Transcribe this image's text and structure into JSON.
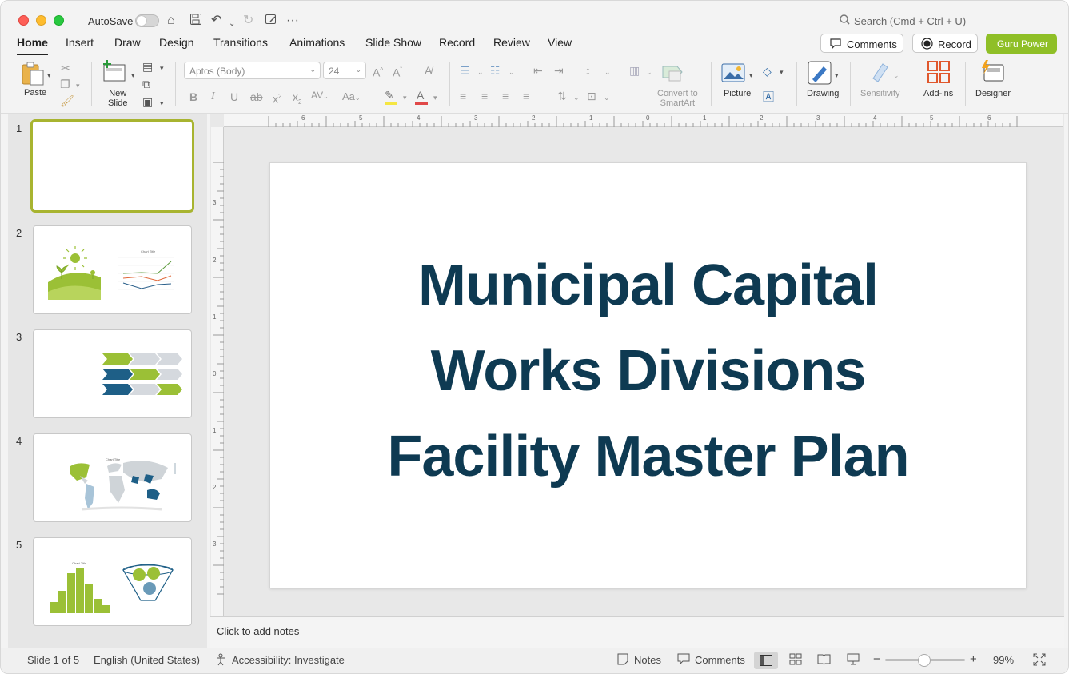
{
  "titlebar": {
    "autosave_label": "AutoSave",
    "search_placeholder": "Search (Cmd + Ctrl + U)"
  },
  "tabs": [
    "Home",
    "Insert",
    "Draw",
    "Design",
    "Transitions",
    "Animations",
    "Slide Show",
    "Record",
    "Review",
    "View"
  ],
  "header_buttons": {
    "comments": "Comments",
    "record": "Record",
    "guru": "Guru Power"
  },
  "ribbon": {
    "paste": "Paste",
    "new_slide_line1": "New",
    "new_slide_line2": "Slide",
    "font_name": "Aptos (Body)",
    "font_size": "24",
    "convert_line1": "Convert to",
    "convert_line2": "SmartArt",
    "picture": "Picture",
    "drawing": "Drawing",
    "sensitivity": "Sensitivity",
    "addins": "Add-ins",
    "designer": "Designer"
  },
  "thumbnails": [
    "1",
    "2",
    "3",
    "4",
    "5"
  ],
  "slide": {
    "title_lines": [
      "Municipal Capital",
      "Works Divisions",
      "Facility Master Plan"
    ]
  },
  "notes_placeholder": "Click to add notes",
  "ruler": {
    "h_ticks": [
      "6",
      "5",
      "4",
      "3",
      "2",
      "1",
      "0",
      "1",
      "2",
      "3",
      "4",
      "5",
      "6"
    ],
    "v_ticks": [
      "3",
      "2",
      "1",
      "0",
      "1",
      "2",
      "3"
    ]
  },
  "status": {
    "slide_of": "Slide 1 of 5",
    "language": "English (United States)",
    "accessibility": "Accessibility: Investigate",
    "notes": "Notes",
    "comments": "Comments",
    "zoom_minus": "−",
    "zoom_plus": "+",
    "zoom_level": "99%"
  },
  "thumb_chart_titles": {
    "s2": "Chart Title",
    "s4": "Chart Title",
    "s5": "Chart Title"
  },
  "colors": {
    "accent_green": "#8fbf27",
    "title_navy": "#0e3a52",
    "thumb_blue": "#1e5f87"
  }
}
